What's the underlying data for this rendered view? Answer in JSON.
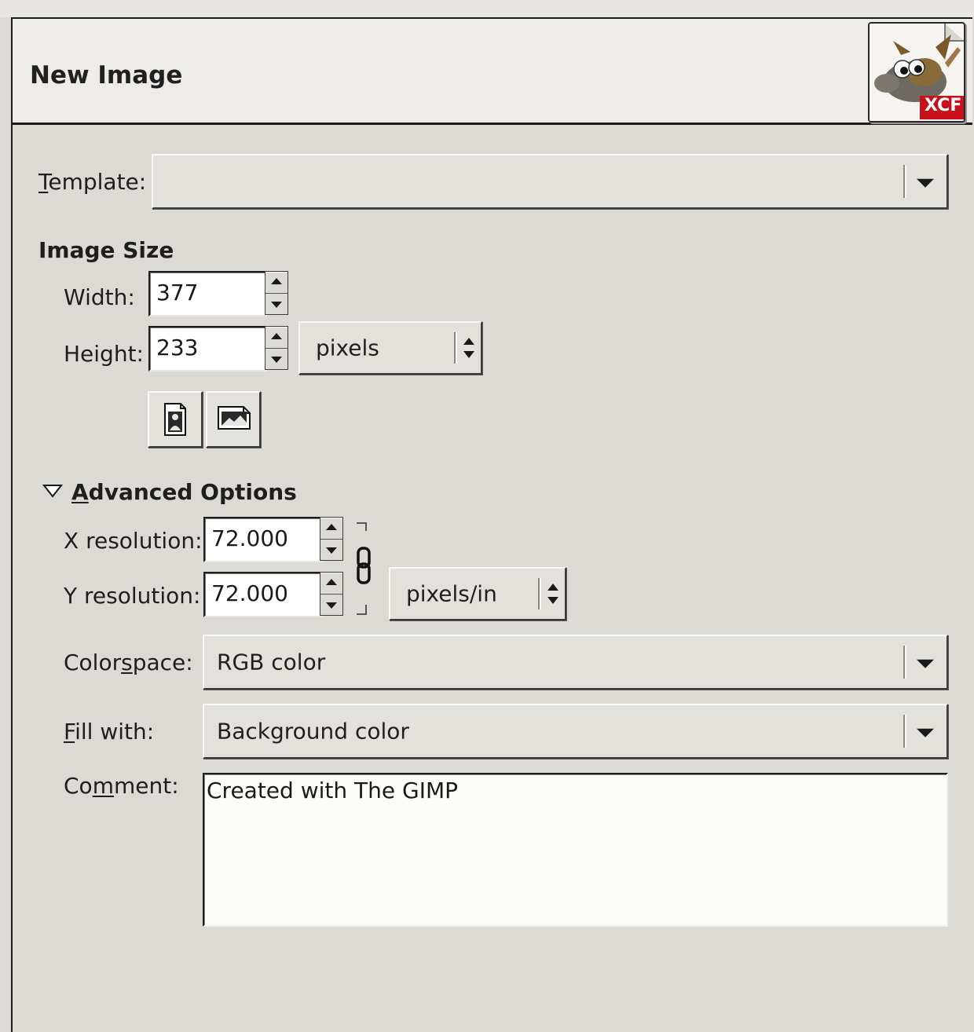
{
  "dialog": {
    "title": "New Image",
    "app_icon": {
      "name": "gimp-wilber-xcf-icon",
      "badge": "XCF"
    }
  },
  "template": {
    "label_accel": "T",
    "label_rest": "emplate:",
    "value": ""
  },
  "image_size": {
    "heading": "Image Size",
    "width_label": "Width:",
    "width_value": "377",
    "height_label": "Height:",
    "height_value": "233",
    "unit": "pixels",
    "portrait_icon": "portrait-orientation-icon",
    "landscape_icon": "landscape-orientation-icon"
  },
  "advanced": {
    "expander_accel": "A",
    "expander_rest": "dvanced Options",
    "expanded": true,
    "x_res_label": "X resolution:",
    "x_res_value": "72.000",
    "y_res_label": "Y resolution:",
    "y_res_value": "72.000",
    "res_unit": "pixels/in",
    "chain_icon": "chain-link-icon",
    "colorspace_label_pre": "Color",
    "colorspace_label_accel": "s",
    "colorspace_label_post": "pace:",
    "colorspace_value": "RGB color",
    "fill_label_accel": "F",
    "fill_label_rest": "ill with:",
    "fill_value": "Background color",
    "comment_label_pre": "Co",
    "comment_label_accel": "m",
    "comment_label_post": "ment:",
    "comment_value": "Created with The GIMP"
  },
  "colors": {
    "dialog_bg": "#dcdad5",
    "header_bg": "#edece9",
    "entry_bg": "#ffffff",
    "xcf_badge": "#c8101a"
  }
}
